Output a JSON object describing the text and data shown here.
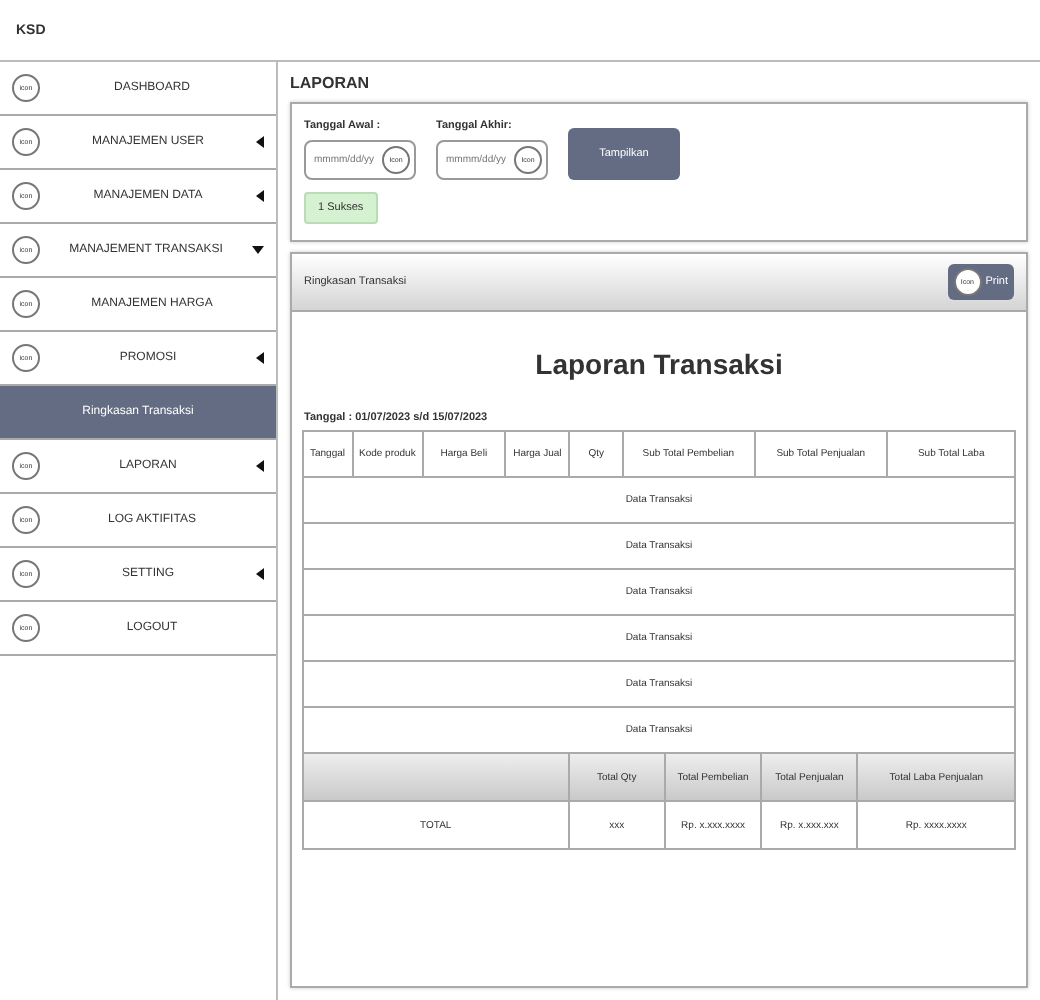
{
  "app": {
    "title": "KSD"
  },
  "sidebar": {
    "items": [
      {
        "kind": "menu",
        "label": "DASHBOARD",
        "icon_text": "icon",
        "selected": false
      },
      {
        "kind": "menu",
        "label": "MANAJEMEN USER",
        "icon_text": "icon",
        "expanded": false,
        "selected": false
      },
      {
        "kind": "menu",
        "label": "MANAJEMEN DATA",
        "icon_text": "icon",
        "expanded": false,
        "selected": false
      },
      {
        "kind": "menu",
        "label": "MANAJEMENT TRANSAKSI",
        "icon_text": "icon",
        "expanded": true,
        "selected": false
      },
      {
        "kind": "menu",
        "label": "MANAJEMEN HARGA",
        "icon_text": "icon",
        "selected": false
      },
      {
        "kind": "menu",
        "label": "PROMOSI",
        "icon_text": "icon",
        "expanded": false,
        "selected": false
      },
      {
        "kind": "submenu",
        "label": "Ringkasan Transaksi",
        "selected": true
      },
      {
        "kind": "menu",
        "label": "LAPORAN",
        "icon_text": "icon",
        "expanded": false,
        "selected": false
      },
      {
        "kind": "menu",
        "label": "LOG AKTIFITAS",
        "icon_text": "icon",
        "selected": false
      },
      {
        "kind": "menu",
        "label": "SETTING",
        "icon_text": "icon",
        "expanded": false,
        "selected": false
      },
      {
        "kind": "menu",
        "label": "LOGOUT",
        "icon_text": "icon",
        "selected": false
      }
    ]
  },
  "page_title": "LAPORAN",
  "filter": {
    "fields": [
      {
        "label": "Tanggal Awal :",
        "placeholder": "mmmm/dd/yy",
        "icon_text": "Icon"
      },
      {
        "label": "Tanggal Akhir:",
        "placeholder": "mmmm/dd/yy",
        "icon_text": "Icon"
      }
    ],
    "button": "Tampilkan",
    "status": "1 Sukses"
  },
  "report": {
    "header": "Ringkasan Transaksi",
    "print_button": {
      "icon_text": "Icon",
      "label": "Print"
    },
    "title": "Laporan Transaksi",
    "date_range": "Tanggal : 01/07/2023  s/d 15/07/2023",
    "table": {
      "columns": [
        "Tanggal",
        "Kode produk",
        "Harga Beli",
        "Harga Jual",
        "Qty",
        "Sub Total Pembelian",
        "Sub Total Penjualan",
        "Sub Total Laba"
      ],
      "rows": [
        "Data Transaksi",
        "Data Transaksi",
        "Data Transaksi",
        "Data Transaksi",
        "Data Transaksi",
        "Data Transaksi"
      ],
      "total_header": [
        "Total Qty",
        "Total Pembelian",
        "Total Penjualan",
        "Total Laba Penjualan"
      ],
      "total_row": [
        "TOTAL",
        "xxx",
        "Rp. x.xxx.xxxx",
        "Rp. x.xxx.xxx",
        "Rp. xxxx.xxxx"
      ]
    }
  }
}
